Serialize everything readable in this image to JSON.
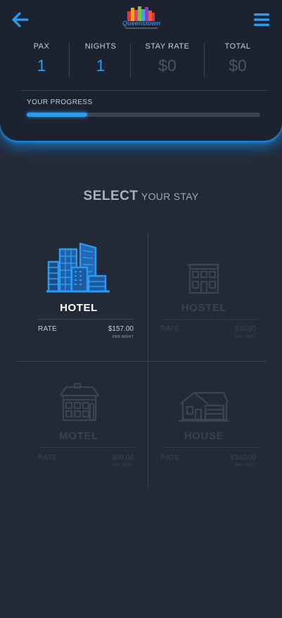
{
  "header": {
    "logo_text": "Queenstown",
    "stats": [
      {
        "label": "PAX",
        "value": "1",
        "muted": false
      },
      {
        "label": "NIGHTS",
        "value": "1",
        "muted": false
      },
      {
        "label": "STAY RATE",
        "value": "$0",
        "muted": true
      },
      {
        "label": "TOTAL",
        "value": "$0",
        "muted": true
      }
    ],
    "progress": {
      "label": "YOUR PROGRESS",
      "fraction": 0.26
    }
  },
  "select": {
    "strong": "SELECT",
    "light": "YOUR STAY"
  },
  "options": [
    {
      "name": "HOTEL",
      "rate_label": "RATE",
      "rate_value": "$157.00",
      "per_night": "PER NIGHT",
      "icon": "city-buildings-icon",
      "active": true
    },
    {
      "name": "HOSTEL",
      "rate_label": "RATE",
      "rate_value": "$30.00",
      "per_night": "PER NIGHT",
      "icon": "hostel-building-icon",
      "active": false
    },
    {
      "name": "MOTEL",
      "rate_label": "RATE",
      "rate_value": "$90.00",
      "per_night": "PER NIGHT",
      "icon": "motel-building-icon",
      "active": false
    },
    {
      "name": "HOUSE",
      "rate_label": "RATE",
      "rate_value": "$240.00",
      "per_night": "PER NIGHT",
      "icon": "house-icon",
      "active": false
    }
  ],
  "colors": {
    "accent": "#2a9bf0",
    "background": "#232a37",
    "card": "#1c2230",
    "muted": "#394255"
  }
}
